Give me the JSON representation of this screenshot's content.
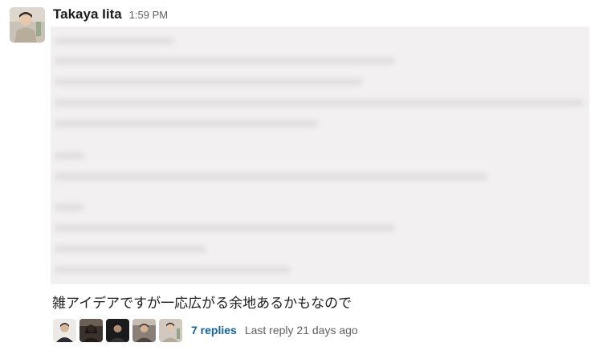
{
  "message": {
    "sender": "Takaya Iita",
    "timestamp": "1:59 PM",
    "avatar_icon": "user-photo-avatar",
    "body_text": "雑アイデアですが一応広がる余地あるかもなので"
  },
  "thread": {
    "participant_avatars": [
      "user-avatar-1",
      "user-avatar-2",
      "user-avatar-3",
      "user-avatar-4",
      "user-avatar-5"
    ],
    "reply_count_label": "7 replies",
    "last_reply_label": "Last reply 21 days ago"
  },
  "colors": {
    "link": "#1264a3",
    "muted": "#616061",
    "text": "#1d1c1d",
    "redacted_background": "#f2f0f1"
  }
}
